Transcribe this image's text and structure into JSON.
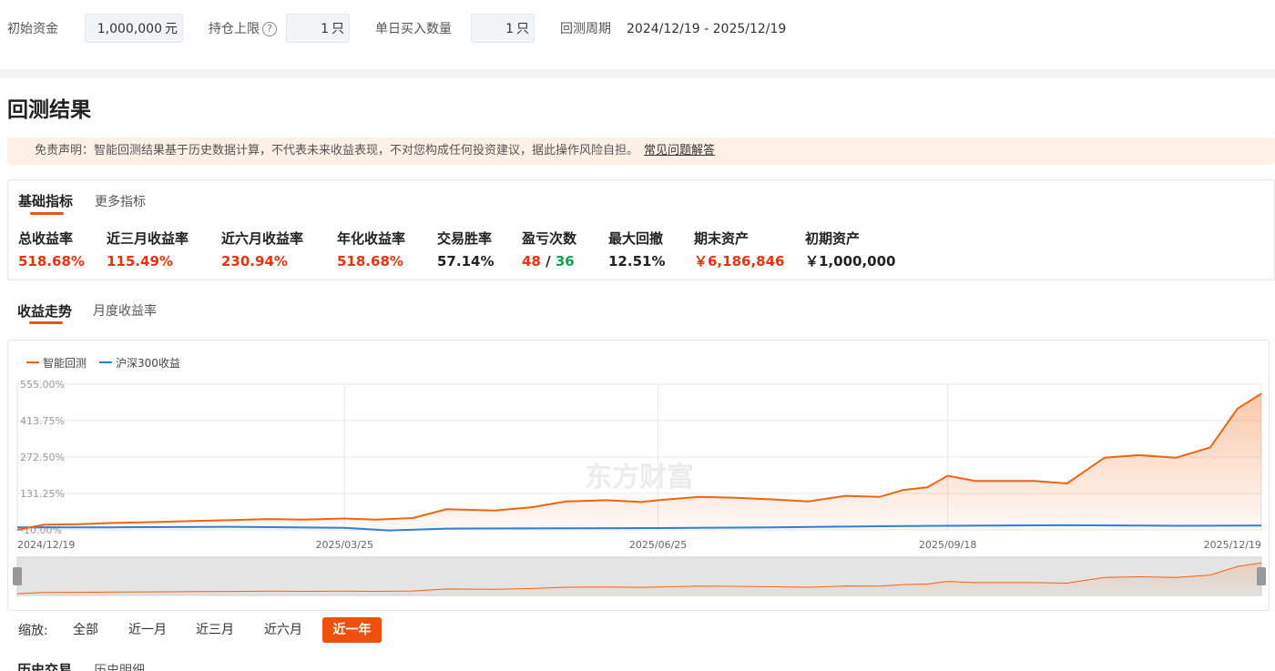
{
  "params": {
    "initial_capital_label": "初始资金",
    "initial_capital_value": "1,000,000",
    "initial_capital_unit": "元",
    "position_limit_label": "持仓上限",
    "position_limit_value": "1",
    "position_limit_unit": "只",
    "daily_buy_label": "单日买入数量",
    "daily_buy_value": "1",
    "daily_buy_unit": "只",
    "period_label": "回测周期",
    "period_value": "2024/12/19 - 2025/12/19",
    "help_icon": "question-circle-icon"
  },
  "title": "回测结果",
  "disclaimer": {
    "text": "免责声明：智能回测结果基于历史数据计算，不代表未来收益表现，不对您构成任何投资建议，据此操作风险自担。",
    "faq_link": "常见问题解答"
  },
  "metrics_tabs": [
    "基础指标",
    "更多指标"
  ],
  "metrics": [
    {
      "label": "总收益率",
      "value": "518.68%",
      "color": "#e8330c"
    },
    {
      "label": "近三月收益率",
      "value": "115.49%",
      "color": "#e8330c"
    },
    {
      "label": "近六月收益率",
      "value": "230.94%",
      "color": "#e8330c"
    },
    {
      "label": "年化收益率",
      "value": "518.68%",
      "color": "#e8330c"
    },
    {
      "label": "交易胜率",
      "value": "57.14%",
      "color": "#222222"
    },
    {
      "label": "盈亏次数",
      "value_win": "48",
      "sep": "/",
      "value_loss": "36"
    },
    {
      "label": "最大回撤",
      "value": "12.51%",
      "color": "#222222"
    },
    {
      "label": "期末资产",
      "value": "￥6,186,846",
      "color": "#e8330c"
    },
    {
      "label": "初期资产",
      "value": "￥1,000,000",
      "color": "#222222"
    }
  ],
  "chart_tabs": [
    "收益走势",
    "月度收益率"
  ],
  "watermark": "东方财富",
  "chart_data": {
    "type": "line",
    "series": [
      {
        "name": "智能回测",
        "color": "#f0640f",
        "x": [
          "2024/12/19",
          "2024/12/27",
          "2025/01/06",
          "2025/01/16",
          "2025/01/27",
          "2025/02/10",
          "2025/02/20",
          "2025/03/03",
          "2025/03/13",
          "2025/03/25",
          "2025/04/03",
          "2025/04/14",
          "2025/04/24",
          "2025/05/08",
          "2025/05/19",
          "2025/05/29",
          "2025/06/10",
          "2025/06/20",
          "2025/06/25",
          "2025/07/07",
          "2025/07/17",
          "2025/07/29",
          "2025/08/08",
          "2025/08/19",
          "2025/08/29",
          "2025/09/05",
          "2025/09/12",
          "2025/09/18",
          "2025/09/26",
          "2025/10/13",
          "2025/10/23",
          "2025/11/03",
          "2025/11/13",
          "2025/11/24",
          "2025/12/04",
          "2025/12/12",
          "2025/12/19"
        ],
        "values": [
          -10,
          10,
          12,
          17,
          20,
          25,
          28,
          32,
          30,
          34,
          30,
          36,
          70,
          65,
          78,
          100,
          105,
          98,
          105,
          118,
          115,
          108,
          100,
          122,
          118,
          145,
          155,
          200,
          180,
          180,
          170,
          270,
          280,
          270,
          310,
          460,
          518.68
        ]
      },
      {
        "name": "沪深300收益",
        "color": "#2f7ed8",
        "x": [
          "2024/12/19",
          "2025/01/16",
          "2025/02/20",
          "2025/03/25",
          "2025/04/07",
          "2025/04/24",
          "2025/05/29",
          "2025/06/25",
          "2025/07/29",
          "2025/08/29",
          "2025/09/18",
          "2025/10/23",
          "2025/11/24",
          "2025/12/19"
        ],
        "values": [
          0,
          0,
          2,
          -2,
          -12,
          -5,
          -4,
          -3,
          0,
          4,
          6,
          8,
          6,
          7
        ]
      }
    ],
    "x_ticks": [
      "2024/12/19",
      "2025/03/25",
      "2025/06/25",
      "2025/09/18",
      "2025/12/19"
    ],
    "y_ticks": [
      "555.00%",
      "413.75%",
      "272.50%",
      "131.25%",
      "-10.00%"
    ],
    "y_tick_values": [
      555,
      413.75,
      272.5,
      131.25,
      -10
    ],
    "ylim": [
      -10,
      555
    ],
    "grid": true,
    "legend": "top-left"
  },
  "zoom": {
    "label": "缩放:",
    "buttons": [
      "全部",
      "近一月",
      "近三月",
      "近六月",
      "近一年"
    ],
    "active_index": 4,
    "active_color": "#f0500e"
  },
  "history_tabs": [
    "历史交易",
    "历史明细"
  ]
}
